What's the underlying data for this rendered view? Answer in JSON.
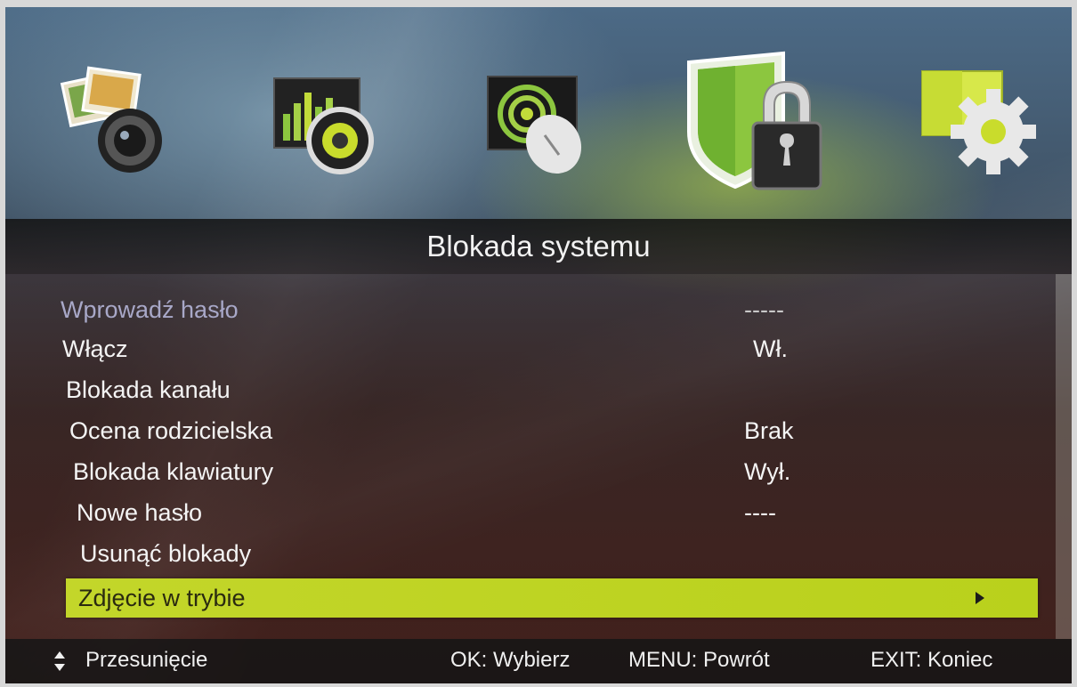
{
  "menu": {
    "title": "Blokada systemu",
    "items": [
      {
        "label": "Wprowadź hasło",
        "value": "-----",
        "state": "disabled"
      },
      {
        "label": "Włącz",
        "value": "Wł.",
        "state": "normal"
      },
      {
        "label": "Blokada kanału",
        "value": "",
        "state": "normal"
      },
      {
        "label": "Ocena rodzicielska",
        "value": "Brak",
        "state": "normal"
      },
      {
        "label": "Blokada klawiatury",
        "value": "Wył.",
        "state": "normal"
      },
      {
        "label": "Nowe hasło",
        "value": "----",
        "state": "normal"
      },
      {
        "label": "Usunąć blokady",
        "value": "",
        "state": "normal"
      },
      {
        "label": "Zdjęcie w trybie",
        "value": "",
        "state": "selected"
      }
    ]
  },
  "icons": [
    "photo-camera-icon",
    "music-speaker-icon",
    "satellite-dish-icon",
    "shield-lock-icon",
    "settings-gear-icon"
  ],
  "active_icon": "shield-lock-icon",
  "footer": {
    "move": "Przesunięcie",
    "ok": "OK: Wybierz",
    "menu": "MENU: Powrót",
    "exit": "EXIT: Koniec"
  },
  "colors": {
    "accent": "#bfd424",
    "text": "#f4f4f4",
    "disabled_text": "#a8a8c8"
  }
}
